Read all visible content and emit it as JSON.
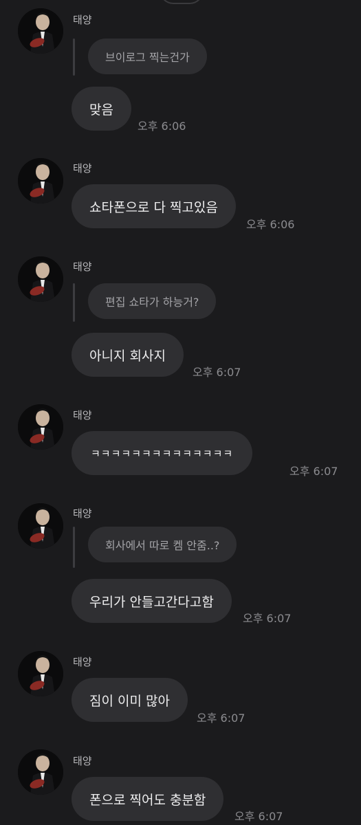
{
  "sender_name": "태양",
  "messages": [
    {
      "reply": "브이로그 찍는건가",
      "text": "맞음",
      "time": "오후 6:06"
    },
    {
      "text": "쇼타폰으로 다 찍고있음",
      "time": "오후 6:06"
    },
    {
      "reply": "편집 쇼타가 하능거?",
      "text": "아니지 회사지",
      "time": "오후 6:07"
    },
    {
      "text": "ㅋㅋㅋㅋㅋㅋㅋㅋㅋㅋㅋㅋㅋㅋ",
      "time": "오후 6:07"
    },
    {
      "reply": "회사에서 따로 켐 안줌..?",
      "text": "우리가 안들고간다고함",
      "time": "오후 6:07"
    },
    {
      "text": "짐이 이미 많아",
      "time": "오후 6:07"
    },
    {
      "text": "폰으로 찍어도 충분함",
      "time": "오후 6:07"
    }
  ]
}
